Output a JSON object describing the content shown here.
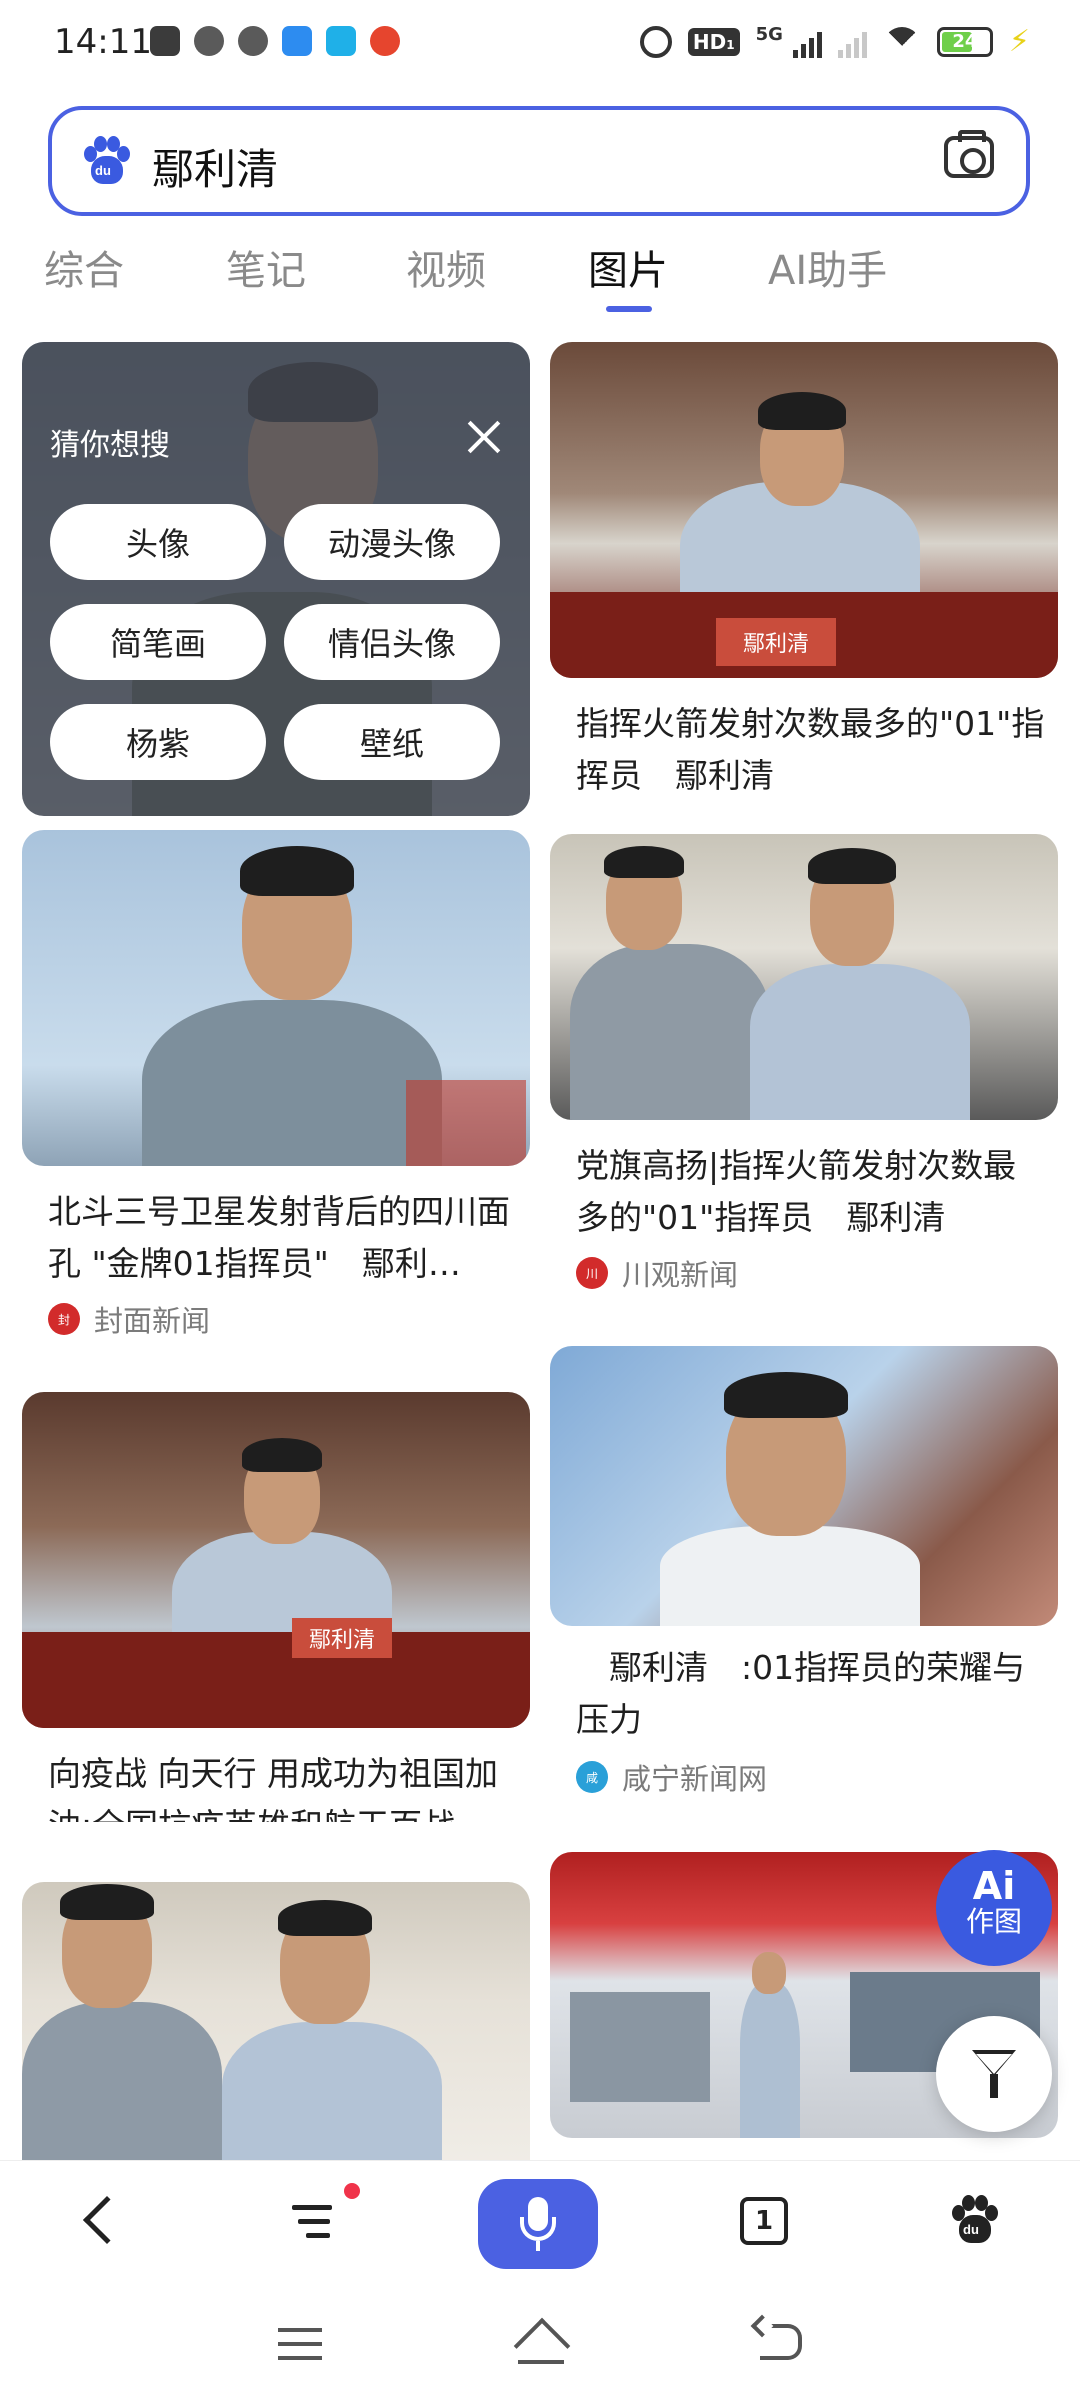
{
  "status_bar": {
    "time": "14:11",
    "battery": "24",
    "network": "5G",
    "hd": "HD",
    "hd_sub": "1"
  },
  "search": {
    "query": "鄢利清"
  },
  "tabs": [
    {
      "label": "综合",
      "active": false
    },
    {
      "label": "笔记",
      "active": false
    },
    {
      "label": "视频",
      "active": false
    },
    {
      "label": "图片",
      "active": true
    },
    {
      "label": "AI助手",
      "active": false
    }
  ],
  "suggestions": {
    "title": "猜你想搜",
    "chips": [
      "头像",
      "动漫头像",
      "简笔画",
      "情侣头像",
      "杨紫",
      "壁纸"
    ]
  },
  "cards": [
    {
      "caption": "指挥火箭发射次数最多的\"01\"指挥员　鄢利清",
      "source": ""
    },
    {
      "caption": "北斗三号卫星发射背后的四川面孔 \"金牌01指挥员\"　鄢利…",
      "source": "封面新闻"
    },
    {
      "caption": "党旗高扬|指挥火箭发射次数最多的\"01\"指挥员　鄢利清",
      "source": "川观新闻"
    },
    {
      "caption": "向疫战 向天行 用成功为祖国加油:全国抗疫英雄和航天百战…",
      "source": ""
    },
    {
      "caption": "　鄢利清　:01指挥员的荣耀与压力",
      "source": "咸宁新闻网"
    }
  ],
  "image_text": {
    "name_sign": "鄢利清"
  },
  "fab": {
    "ai_line1": "Ai",
    "ai_line2": "作图"
  },
  "toolbar": {
    "tab_count": "1"
  },
  "colors": {
    "accent": "#4b61e2",
    "badge": "#f0334a"
  }
}
